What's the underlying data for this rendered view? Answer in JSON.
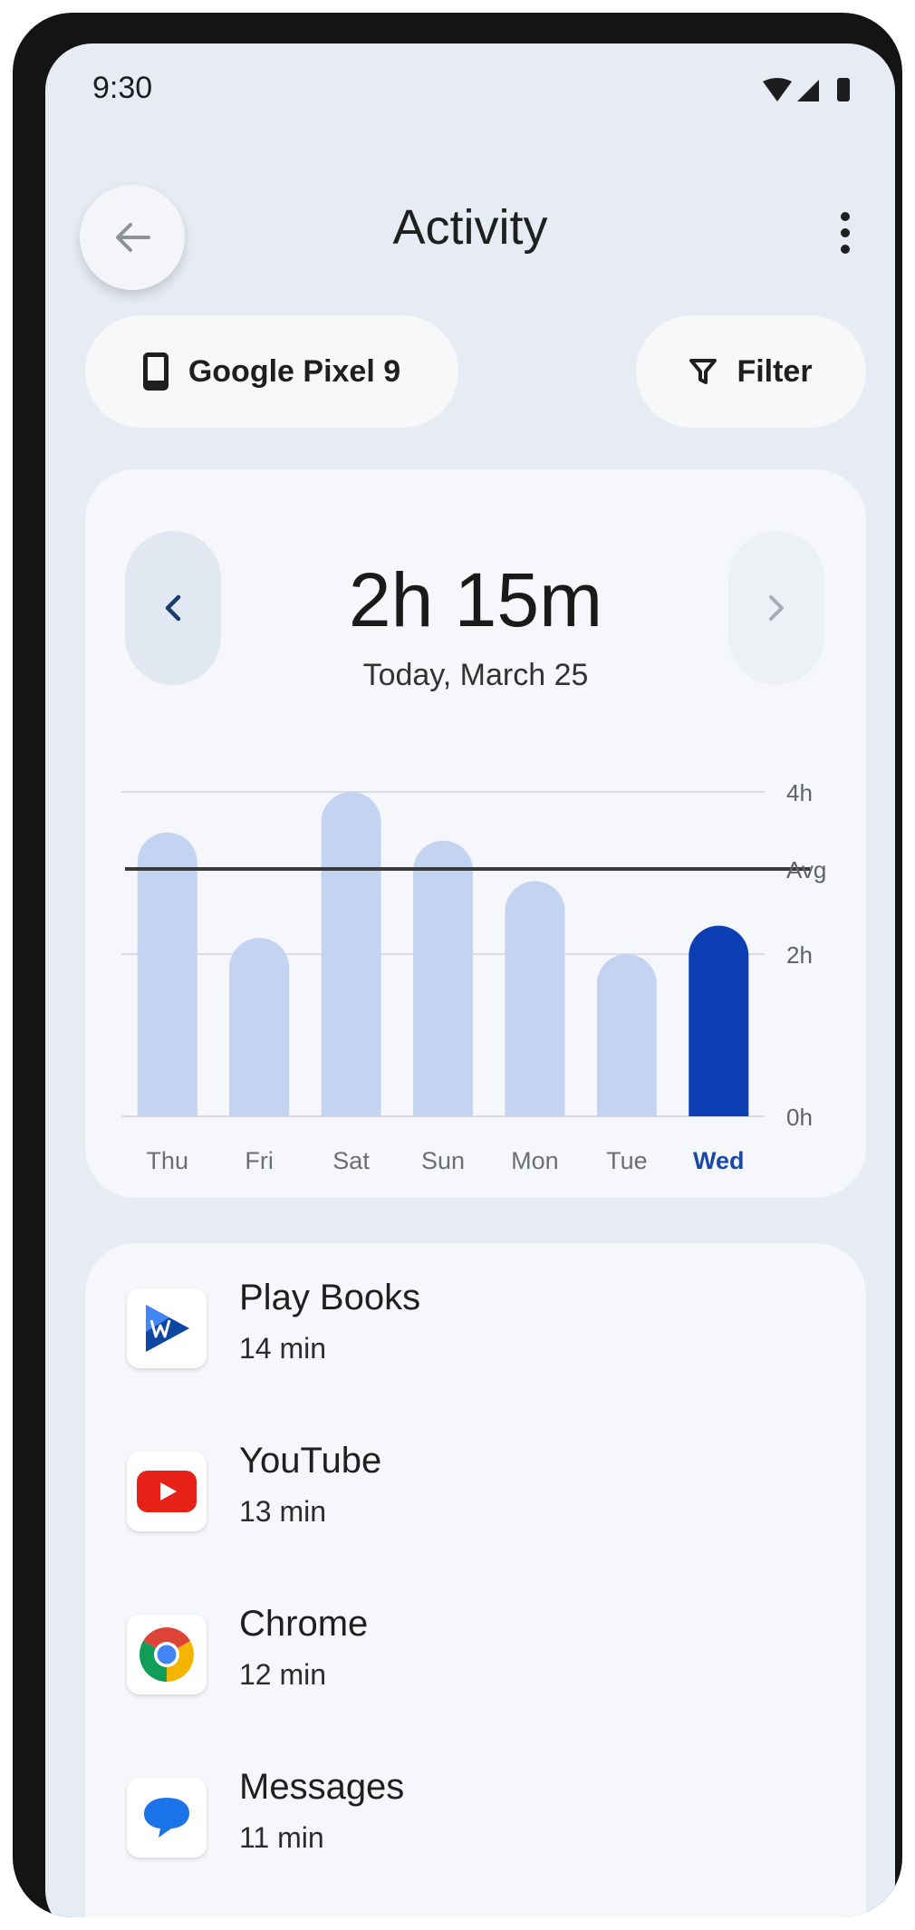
{
  "status": {
    "time": "9:30"
  },
  "appbar": {
    "title": "Activity"
  },
  "device_chip": {
    "label": "Google Pixel 9"
  },
  "filter_chip": {
    "label": "Filter"
  },
  "summary": {
    "total": "2h 15m",
    "date": "Today, March 25"
  },
  "chart_data": {
    "type": "bar",
    "categories": [
      "Thu",
      "Fri",
      "Sat",
      "Sun",
      "Mon",
      "Tue",
      "Wed"
    ],
    "values": [
      3.5,
      2.2,
      4.0,
      3.4,
      2.9,
      2.0,
      2.35
    ],
    "selected_index": 6,
    "average": 3.05,
    "average_label": "Avg",
    "ylim": [
      0,
      4
    ],
    "yticks": [
      {
        "value": 4,
        "label": "4h"
      },
      {
        "value": 2,
        "label": "2h"
      },
      {
        "value": 0,
        "label": "0h"
      }
    ],
    "grid": true,
    "colors": {
      "bar": "#c2d4f2",
      "selected": "#0b3fb3",
      "avg_line": "#3a3a3a",
      "grid": "#d9dde3"
    }
  },
  "apps": [
    {
      "name": "Play Books",
      "time": "14 min",
      "icon": "play-books-icon"
    },
    {
      "name": "YouTube",
      "time": "13 min",
      "icon": "youtube-icon"
    },
    {
      "name": "Chrome",
      "time": "12 min",
      "icon": "chrome-icon"
    },
    {
      "name": "Messages",
      "time": "11 min",
      "icon": "messages-icon"
    }
  ]
}
